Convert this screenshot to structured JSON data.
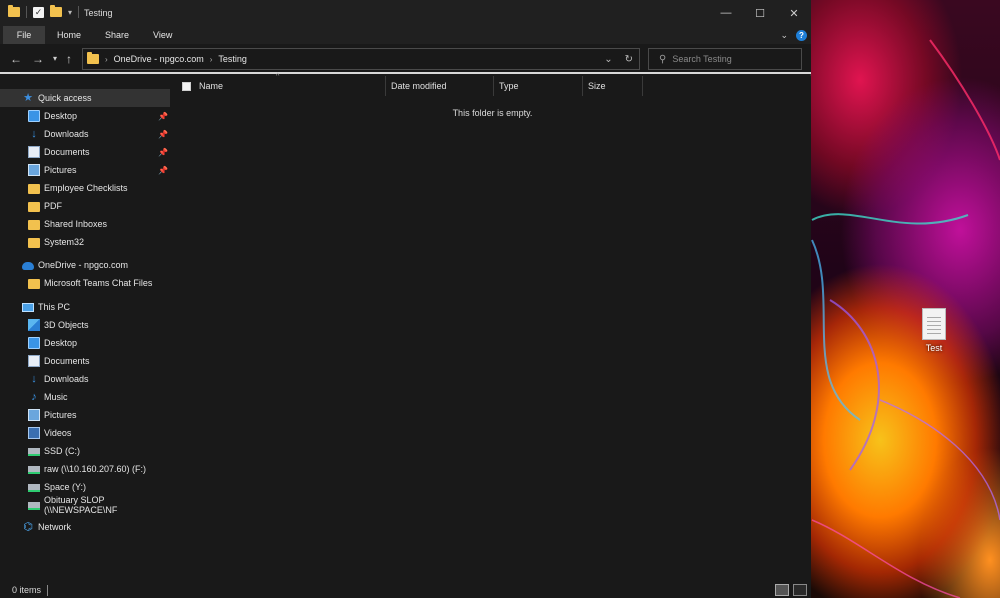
{
  "window": {
    "title": "Testing",
    "controls": {
      "minimize": "—",
      "maximize": "☐",
      "close": "✕"
    }
  },
  "ribbon": {
    "tabs": [
      {
        "label": "File"
      },
      {
        "label": "Home"
      },
      {
        "label": "Share"
      },
      {
        "label": "View"
      }
    ]
  },
  "address": {
    "crumbs": [
      "OneDrive - npgco.com",
      "Testing"
    ]
  },
  "search": {
    "placeholder": "Search Testing"
  },
  "nav": {
    "quick_access": "Quick access",
    "quick_items": [
      {
        "label": "Desktop",
        "pinned": true
      },
      {
        "label": "Downloads",
        "pinned": true
      },
      {
        "label": "Documents",
        "pinned": true
      },
      {
        "label": "Pictures",
        "pinned": true
      },
      {
        "label": "Employee Checklists"
      },
      {
        "label": "PDF"
      },
      {
        "label": "Shared Inboxes"
      },
      {
        "label": "System32"
      }
    ],
    "onedrive": "OneDrive - npgco.com",
    "onedrive_items": [
      {
        "label": "Microsoft Teams Chat Files"
      }
    ],
    "this_pc": "This PC",
    "pc_items": [
      {
        "label": "3D Objects"
      },
      {
        "label": "Desktop"
      },
      {
        "label": "Documents"
      },
      {
        "label": "Downloads"
      },
      {
        "label": "Music"
      },
      {
        "label": "Pictures"
      },
      {
        "label": "Videos"
      },
      {
        "label": "SSD (C:)"
      },
      {
        "label": "raw (\\\\10.160.207.60) (F:)"
      },
      {
        "label": "Space (Y:)"
      },
      {
        "label": "Obituary SLOP (\\\\NEWSPACE\\NF"
      }
    ],
    "network": "Network"
  },
  "columns": {
    "name": "Name",
    "date_modified": "Date modified",
    "type": "Type",
    "size": "Size"
  },
  "content": {
    "empty_message": "This folder is empty."
  },
  "status": {
    "item_count": "0 items"
  },
  "desktop": {
    "icon_label": "Test"
  }
}
